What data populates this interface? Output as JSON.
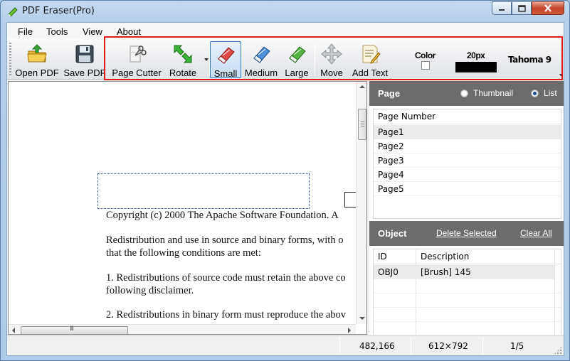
{
  "window": {
    "title": "PDF Eraser(Pro)"
  },
  "menu": [
    "File",
    "Tools",
    "View",
    "About"
  ],
  "toolbar": {
    "buttons": [
      {
        "label": "Open PDF",
        "icon": "open-folder-icon"
      },
      {
        "label": "Save PDF",
        "icon": "floppy-disk-icon"
      },
      {
        "label": "Page Cutter",
        "icon": "scissors-page-icon"
      },
      {
        "label": "Rotate",
        "icon": "rotate-arrows-icon"
      },
      {
        "label": "Small",
        "icon": "eraser-small-icon",
        "selected": true
      },
      {
        "label": "Medium",
        "icon": "eraser-medium-icon"
      },
      {
        "label": "Large",
        "icon": "eraser-large-icon"
      },
      {
        "label": "Move",
        "icon": "move-cross-icon"
      },
      {
        "label": "Add Text",
        "icon": "add-text-icon"
      }
    ],
    "color_label": "Color",
    "size_label": "20px",
    "font_label": "Tahoma 9",
    "highlight_color": "#e01b1b"
  },
  "document": {
    "lines": [
      "Copyright (c) 2000 The Apache Software Foundation.  A",
      "Redistribution and use in source and binary forms, with o",
      "that the following conditions are met:",
      "1. Redistributions of source code must retain the above co",
      "following disclaimer.",
      "2. Redistributions in binary form must reproduce the abov"
    ],
    "hscroll_grip": "III"
  },
  "page_panel": {
    "title": "Page",
    "view_options": [
      "Thumbnail",
      "List"
    ],
    "selected_view": "List",
    "column": "Page Number",
    "pages": [
      "Page1",
      "Page2",
      "Page3",
      "Page4",
      "Page5"
    ],
    "selected_page": "Page1"
  },
  "object_panel": {
    "title": "Object",
    "delete_label": "Delete Selected",
    "clear_label": "Clear All",
    "columns": [
      "ID",
      "Description"
    ],
    "rows": [
      {
        "id": "OBJ0",
        "description": "[Brush] 145"
      }
    ]
  },
  "status": {
    "coords": "482,166",
    "page_size": "612×792",
    "page_index": "1/5"
  }
}
